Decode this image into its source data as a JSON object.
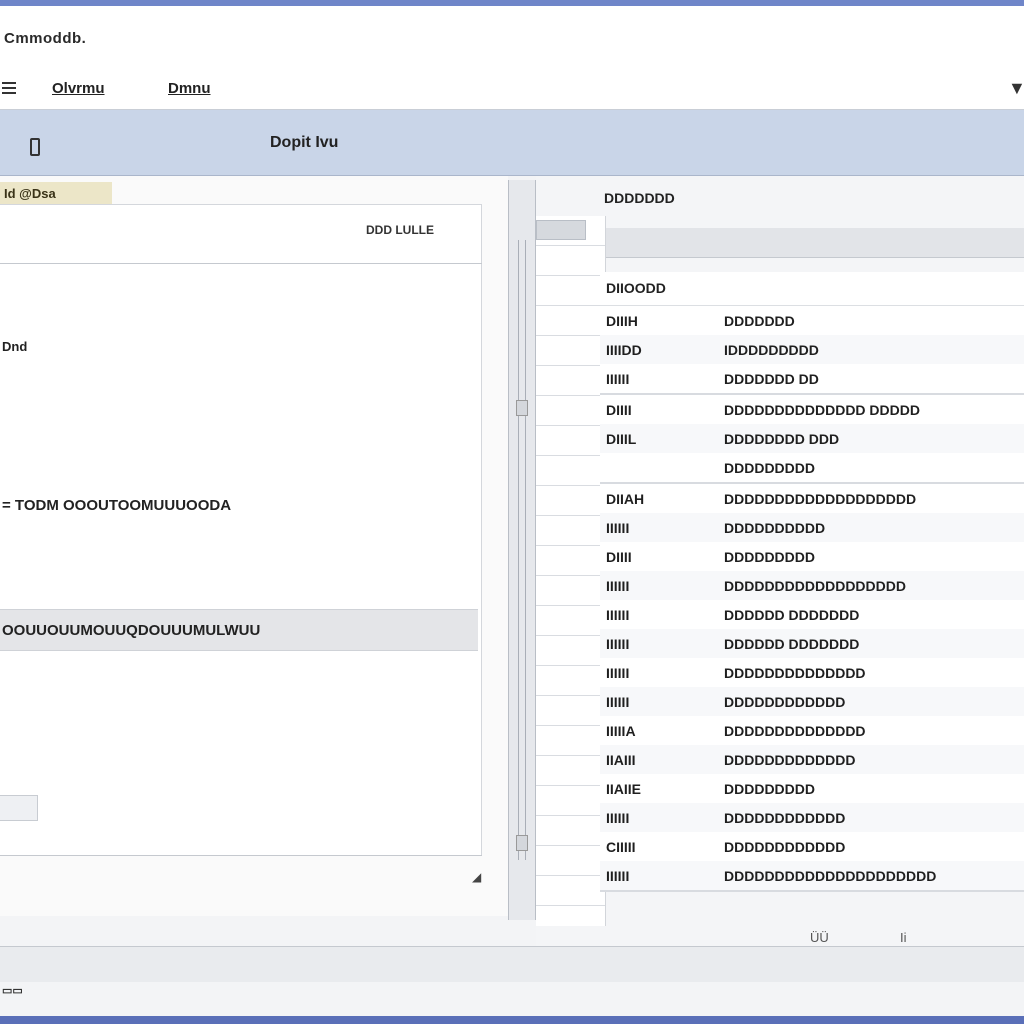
{
  "window": {
    "title": "Cmmoddb.",
    "close_glyph": "▼"
  },
  "menu": {
    "items": [
      "Olvrmu",
      "Dmnu"
    ]
  },
  "toolbar": {
    "title": "Dopit Ivu"
  },
  "left_pane": {
    "header": "Id @Dsa",
    "card_label_right": "DDD LULLE",
    "short_label": "Dnd",
    "long_label": "= TODM  OOOUTOOMUUUOODA",
    "section_label": "OOUUOUUMOUUQDOUUUMULWUU",
    "grip_glyph": "◢"
  },
  "right_pane": {
    "title": "DDDDDDD",
    "group_head": "DIIOODD",
    "groups": [
      [
        {
          "key": "DIIIH",
          "value": "DDDDDDD"
        },
        {
          "key": "IIIIDD",
          "value": "IDDDDDDDDD"
        },
        {
          "key": "IIIIII",
          "value": "DDDDDDD DD"
        }
      ],
      [
        {
          "key": "DIIII",
          "value": "DDDDDDDDDDDDDD DDDDD"
        },
        {
          "key": "DIIIL",
          "value": "DDDDDDDD DDD"
        },
        {
          "key": "",
          "value": "DDDDDDDDD"
        }
      ],
      [
        {
          "key": "DIIAH",
          "value": "DDDDDDDDDDDDDDDDDDD"
        },
        {
          "key": "IIIIII",
          "value": "DDDDDDDDDD"
        },
        {
          "key": "DIIII",
          "value": "DDDDDDDDD"
        },
        {
          "key": "IIIIII",
          "value": "DDDDDDDDDDDDDDDDDD"
        },
        {
          "key": "IIIIII",
          "value": "DDDDDD DDDDDDD"
        },
        {
          "key": "IIIIII",
          "value": "DDDDDD DDDDDDD"
        },
        {
          "key": "IIIIII",
          "value": "DDDDDDDDDDDDDD"
        },
        {
          "key": "IIIIII",
          "value": "DDDDDDDDDDDD"
        },
        {
          "key": "IIIIIA",
          "value": "DDDDDDDDDDDDDD"
        },
        {
          "key": "IIAIII",
          "value": "DDDDDDDDDDDDD"
        },
        {
          "key": "IIAIIE",
          "value": "DDDDDDDDD"
        },
        {
          "key": "IIIIII",
          "value": "DDDDDDDDDDDD"
        },
        {
          "key": "CIIIII",
          "value": "DDDDDDDDDDDD"
        },
        {
          "key": "IIIIII",
          "value": "DDDDDDDDDDDDDDDDDDDDD"
        }
      ]
    ]
  },
  "status": {
    "left": "▭▭",
    "mid": "ÜÜ",
    "mid2": "Ii"
  }
}
